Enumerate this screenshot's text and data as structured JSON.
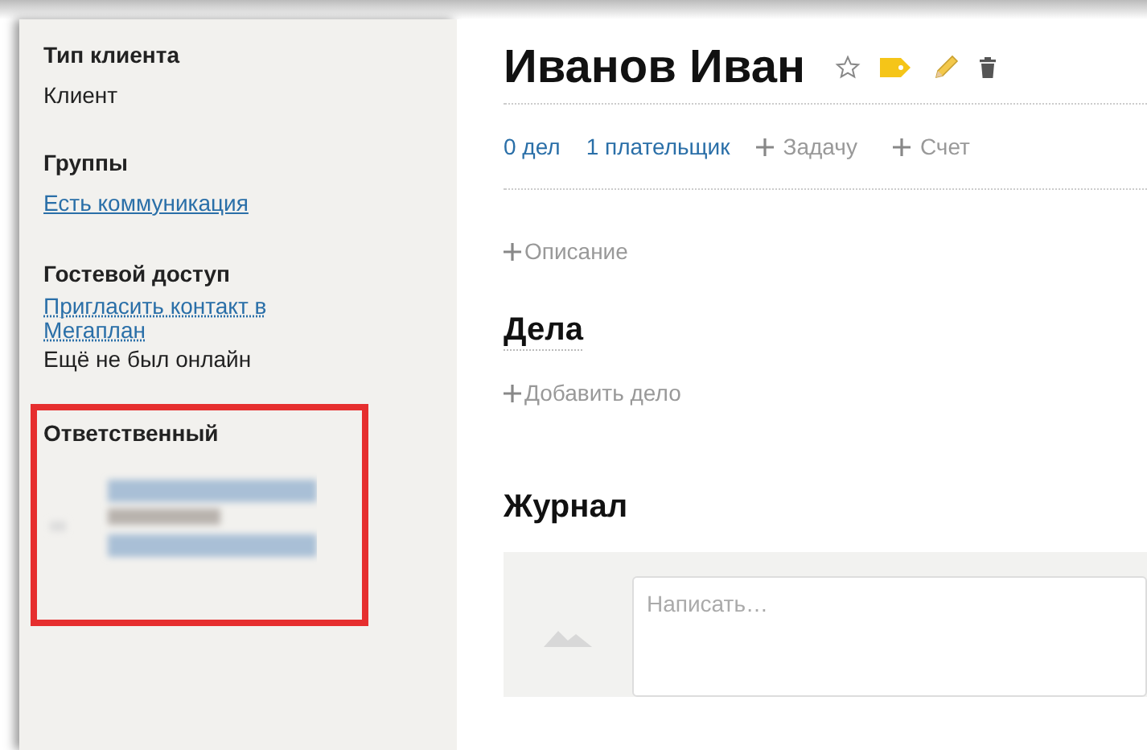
{
  "sidebar": {
    "sections": [
      {
        "heading": "Тип клиента",
        "highlighted": false,
        "items": [
          {
            "kind": "text",
            "text": "Клиент"
          }
        ]
      },
      {
        "heading": "Группы",
        "highlighted": false,
        "items": [
          {
            "kind": "link",
            "text": "Есть коммуникация"
          }
        ]
      },
      {
        "heading": "Гостевой доступ",
        "highlighted": false,
        "items": [
          {
            "kind": "dotted-link",
            "text": "Пригласить контакт в Мегаплан"
          },
          {
            "kind": "text",
            "text": "Ещё не был онлайн"
          }
        ]
      },
      {
        "heading": "Ответственный",
        "highlighted": true,
        "items": [
          {
            "kind": "blurred"
          }
        ]
      }
    ]
  },
  "main": {
    "title": "Иванов Иван",
    "actions": [
      {
        "kind": "link",
        "text": "0 дел"
      },
      {
        "kind": "link",
        "text": "1 плательщик"
      },
      {
        "kind": "add",
        "text": "Задачу"
      },
      {
        "kind": "add",
        "text": "Счет"
      }
    ],
    "description": "Описание",
    "tasks": {
      "heading": "Дела",
      "add": "Добавить дело"
    },
    "journal": {
      "heading": "Журнал",
      "placeholder": "Написать…"
    }
  }
}
